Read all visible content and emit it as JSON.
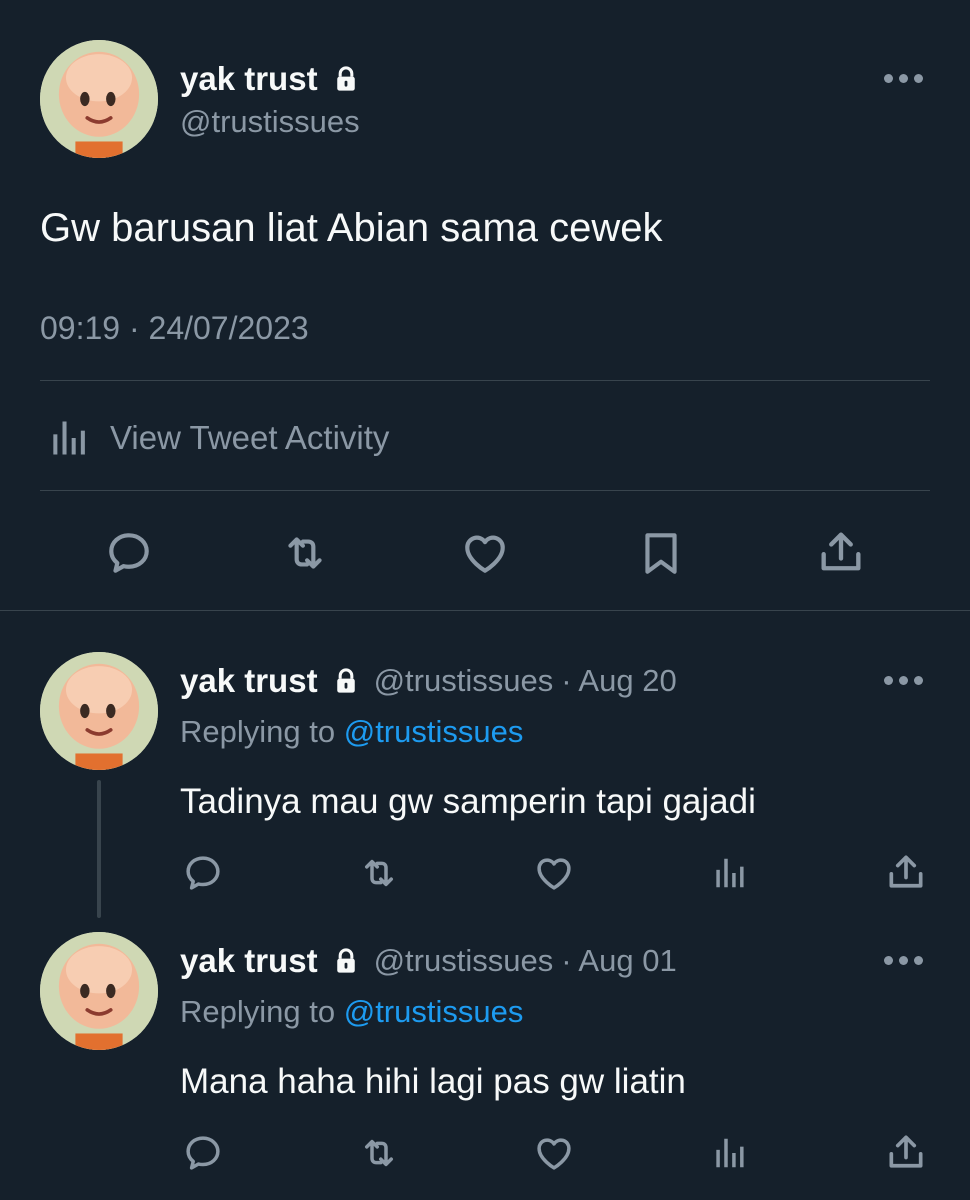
{
  "main_tweet": {
    "display_name": "yak trust",
    "handle": "@trustissues",
    "text": "Gw barusan liat Abian sama cewek",
    "timestamp": "09:19 · 24/07/2023",
    "activity_label": "View Tweet Activity",
    "icons": [
      "lock-icon",
      "more-icon",
      "reply-icon",
      "retweet-icon",
      "like-icon",
      "bookmark-icon",
      "share-icon",
      "analytics-icon"
    ]
  },
  "replies": [
    {
      "display_name": "yak trust",
      "handle": "@trustissues",
      "date": "· Aug 20",
      "replying_prefix": "Replying to",
      "replying_handle": "@trustissues",
      "text": "Tadinya mau gw samperin tapi gajadi"
    },
    {
      "display_name": "yak trust",
      "handle": "@trustissues",
      "date": "· Aug 01",
      "replying_prefix": "Replying to",
      "replying_handle": "@trustissues",
      "text": "Mana haha hihi lagi pas gw liatin"
    }
  ],
  "colors": {
    "background": "#15202b",
    "text": "#f7f9f9",
    "muted": "#8b98a5",
    "link": "#1d9bf0",
    "divider": "#38444d"
  }
}
